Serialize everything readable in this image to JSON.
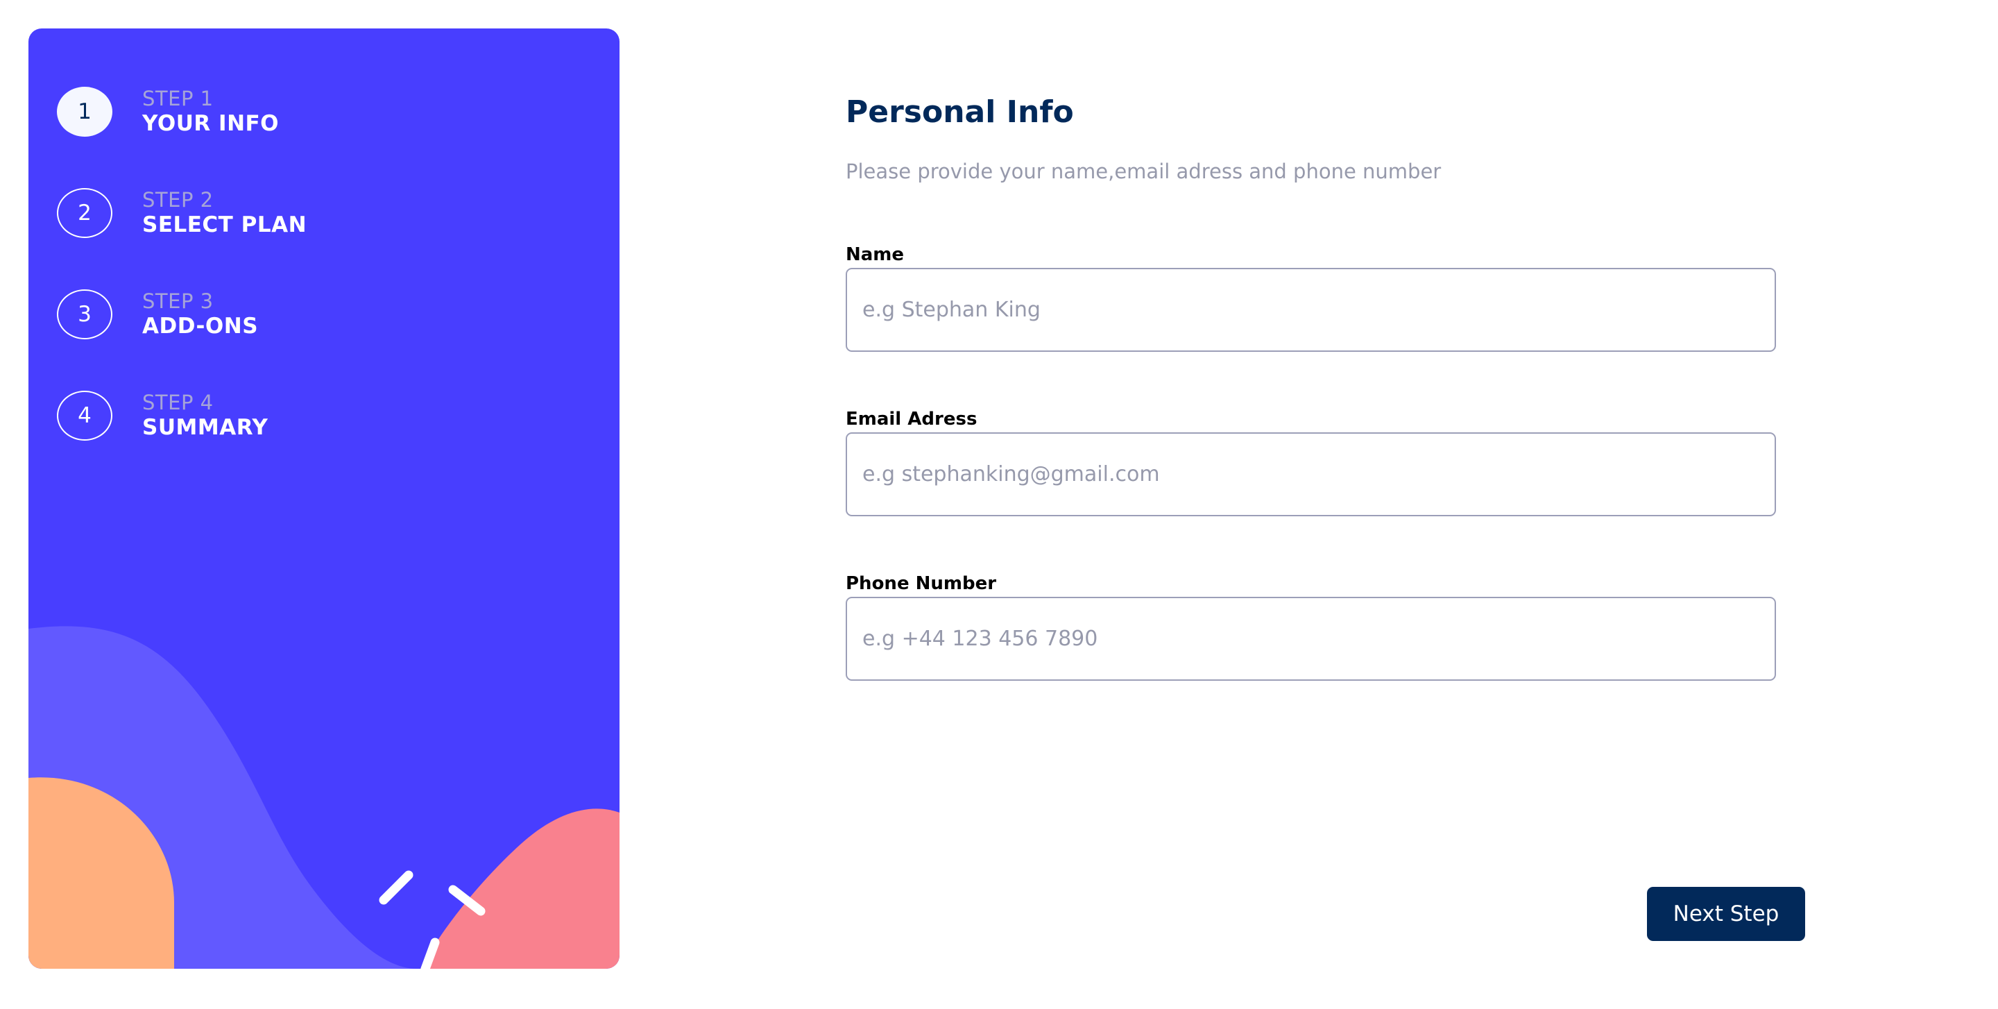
{
  "sidebar": {
    "steps": [
      {
        "number": "1",
        "step_label": "STEP 1",
        "title": "YOUR INFO",
        "active": true
      },
      {
        "number": "2",
        "step_label": "STEP 2",
        "title": "SELECT PLAN",
        "active": false
      },
      {
        "number": "3",
        "step_label": "STEP 3",
        "title": "ADD-ONS",
        "active": false
      },
      {
        "number": "4",
        "step_label": "STEP 4",
        "title": "SUMMARY",
        "active": false
      }
    ]
  },
  "form": {
    "title": "Personal Info",
    "subtitle": "Please provide your name,email adress and phone number",
    "fields": {
      "name": {
        "label": "Name",
        "placeholder": "e.g Stephan King",
        "value": ""
      },
      "email": {
        "label": "Email Adress",
        "placeholder": "e.g stephanking@gmail.com",
        "value": ""
      },
      "phone": {
        "label": "Phone Number",
        "placeholder": "e.g +44 123 456 7890",
        "value": ""
      }
    },
    "next_label": "Next Step"
  },
  "colors": {
    "sidebar_bg": "#483eff",
    "active_step_bg": "#f5f7ff",
    "primary_text": "#02295a",
    "muted_text": "#9699ab",
    "button_bg": "#02295a",
    "deco_purple": "#6259ff",
    "deco_orange": "#ffaf7e",
    "deco_pink": "#f9818e"
  }
}
